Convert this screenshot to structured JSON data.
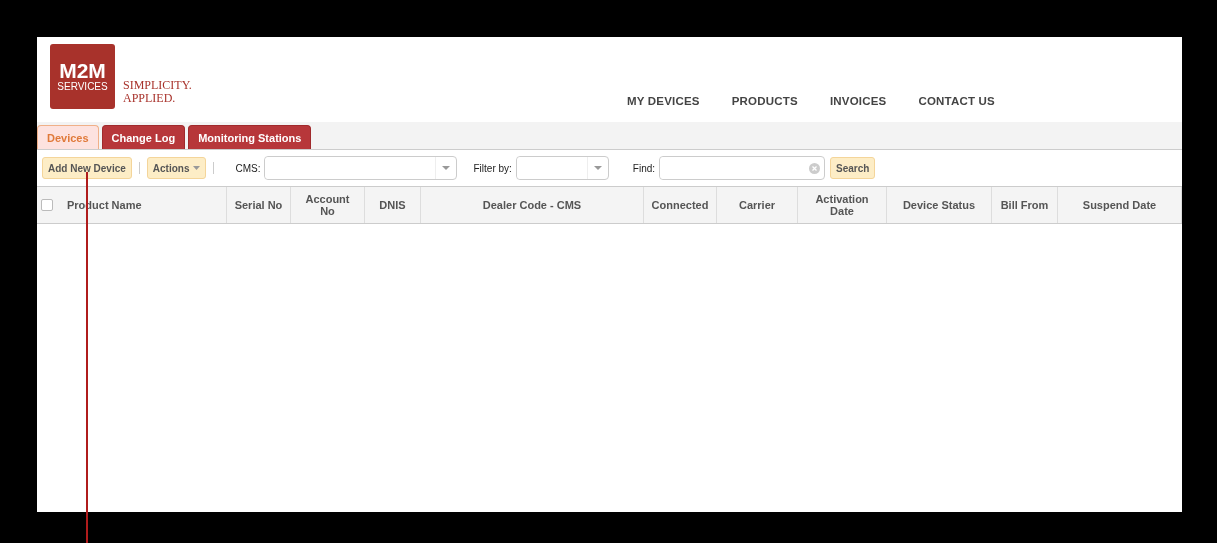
{
  "logo": {
    "mark": "M2M",
    "sub": "SERVICES",
    "tagline": [
      "SIMPLICITY.",
      "APPLIED."
    ]
  },
  "nav": [
    "MY DEVICES",
    "PRODUCTS",
    "INVOICES",
    "CONTACT US"
  ],
  "tabs": [
    {
      "label": "Devices",
      "selected": true
    },
    {
      "label": "Change Log",
      "selected": false
    },
    {
      "label": "Monitoring Stations",
      "selected": false
    }
  ],
  "toolbar": {
    "add_button": "Add New Device",
    "actions_button": "Actions",
    "cms_label": "CMS:",
    "filter_label": "Filter by:",
    "find_label": "Find:",
    "search_button": "Search"
  },
  "table": {
    "select_all": {
      "checked": false
    },
    "columns": [
      "Product Name",
      "Serial No",
      "Account No",
      "DNIS",
      "Dealer Code - CMS",
      "Connected",
      "Carrier",
      "Activation Date",
      "Device Status",
      "Bill From",
      "Suspend Date"
    ]
  }
}
